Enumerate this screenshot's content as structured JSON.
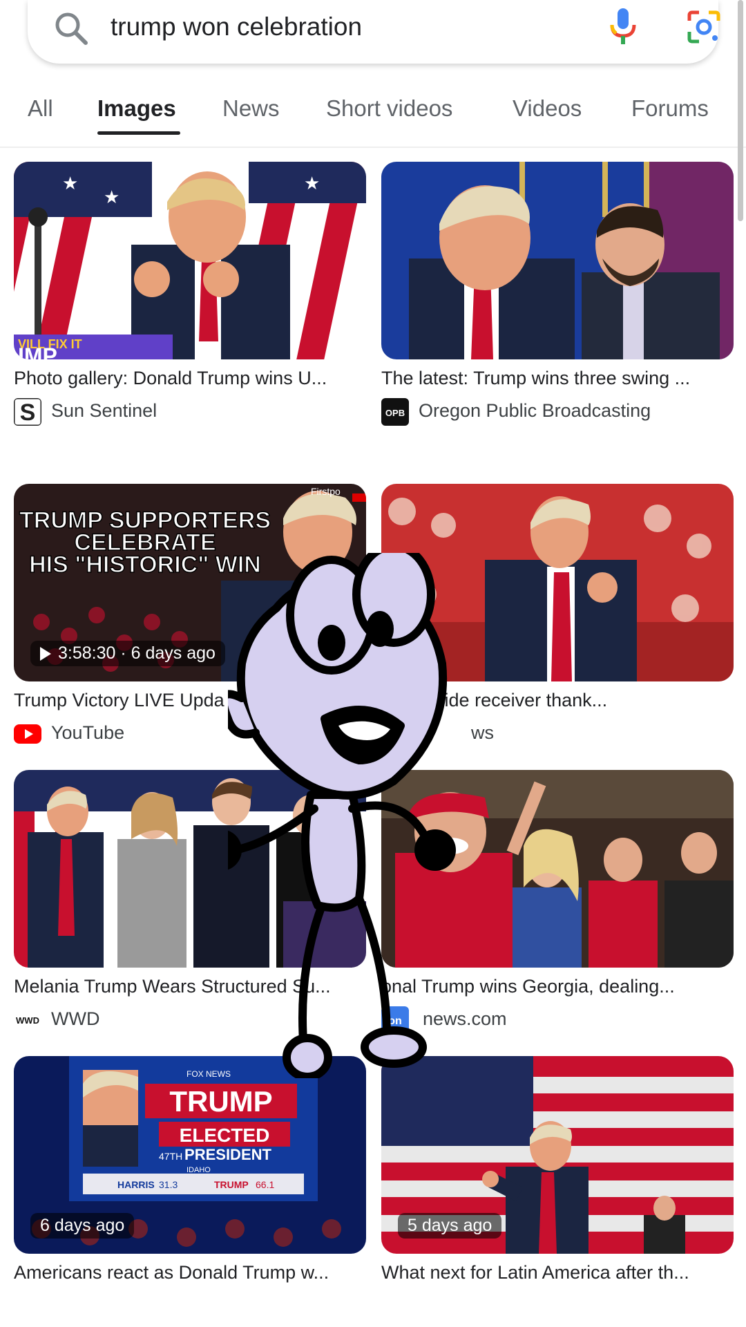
{
  "search": {
    "query": "trump won celebration"
  },
  "tabs": [
    {
      "label": "All"
    },
    {
      "label": "Images"
    },
    {
      "label": "News"
    },
    {
      "label": "Short videos"
    },
    {
      "label": "Videos"
    },
    {
      "label": "Forums"
    }
  ],
  "results": [
    {
      "title": "Photo gallery: Donald Trump wins U...",
      "source": "Sun Sentinel",
      "thumb_text": "VILL FIX IT",
      "thumb_text2": "IMP"
    },
    {
      "title": "The latest: Trump wins three swing ...",
      "source": "Oregon Public Broadcasting",
      "favicon_text": "OPB"
    },
    {
      "title": "Trump Victory LIVE Upda",
      "source": "YouTube",
      "badge": "3:58:30 · 6 days ago",
      "thumb_text": "TRUMP SUPPORTERS",
      "thumb_text2": "CELEBRATE",
      "thumb_text3": "HIS \"HISTORIC\" WIN",
      "thumb_corner": "Firstpo"
    },
    {
      "title": "otball wide receiver thank...",
      "source": "ws"
    },
    {
      "title": "Melania Trump Wears Structured Su...",
      "source": "WWD",
      "favicon_text": "WWD"
    },
    {
      "title": "onal Trump wins Georgia, dealing...",
      "source": "news.com",
      "favicon_text": "on"
    },
    {
      "title": "Americans react as Donald Trump w...",
      "badge": "6 days ago",
      "thumb_text": "TRUMP",
      "thumb_text2": "ELECTED",
      "thumb_text3": "PRESIDENT",
      "thumb_text4": "FOX NEWS",
      "thumb_text5": "HARRIS",
      "thumb_text6": "TRUMP",
      "thumb_text7": "31.3",
      "thumb_text8": "66.1",
      "thumb_text9": "47TH",
      "thumb_text10": "IDAHO"
    },
    {
      "title": "What next for Latin America after th...",
      "badge": "5 days ago"
    }
  ],
  "colors": {
    "google_blue": "#4285F4",
    "google_red": "#EA4335",
    "google_yellow": "#FBBC05",
    "google_green": "#34A853",
    "youtube_red": "#FF0000",
    "cartoon_fill": "#D6D0F0"
  },
  "icons": [
    "search-icon",
    "mic-icon",
    "lens-icon",
    "play-icon"
  ]
}
